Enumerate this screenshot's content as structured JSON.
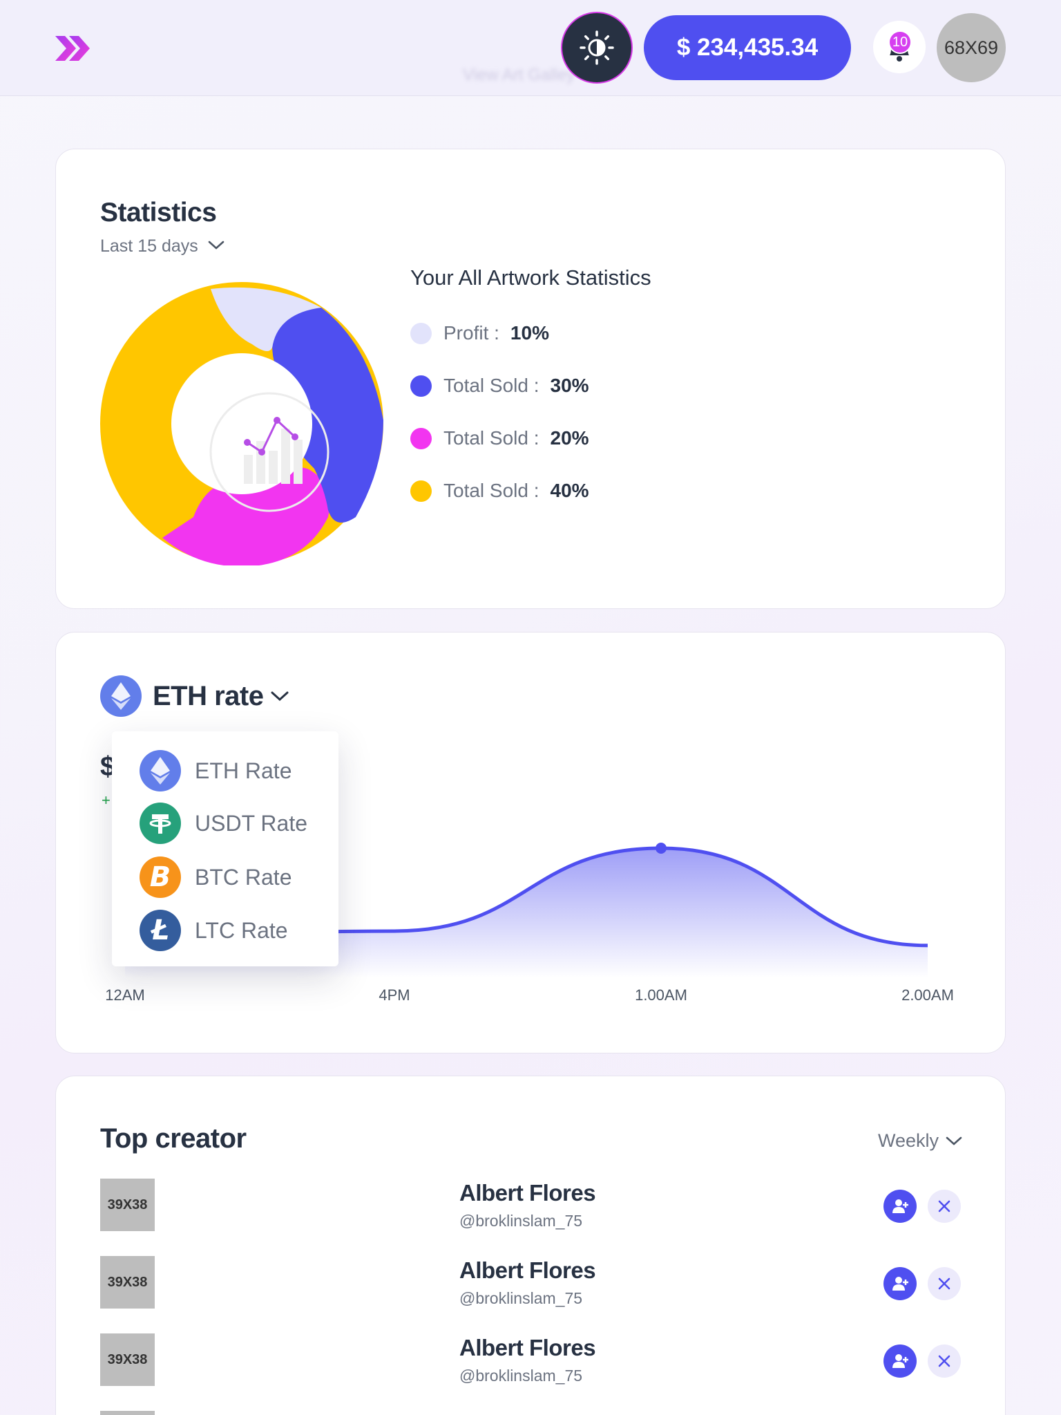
{
  "header": {
    "hint_text": "View Art Galley",
    "balance": "$ 234,435.34",
    "notification_count": "10",
    "avatar_placeholder": "68X69",
    "icons": {
      "logo": "double-chevron-right-icon",
      "theme": "sun-icon",
      "notifications": "bell-icon"
    },
    "colors": {
      "accent": "#4f4ff0",
      "brand": "#c53cf0",
      "theme_button": "#273142"
    }
  },
  "statistics": {
    "title": "Statistics",
    "range": "Last 15 days",
    "legend_title": "Your All Artwork Statistics",
    "legend": [
      {
        "label": "Profit :",
        "value": "10%",
        "color": "#e2e3fb"
      },
      {
        "label": "Total Sold :",
        "value": "30%",
        "color": "#4f4ff0"
      },
      {
        "label": "Total Sold :",
        "value": "20%",
        "color": "#f235f0"
      },
      {
        "label": "Total Sold :",
        "value": "40%",
        "color": "#ffc600"
      }
    ]
  },
  "eth_rate": {
    "title": "ETH rate",
    "hidden_value": "$",
    "hidden_change": "+",
    "dropdown": [
      {
        "label": "ETH Rate",
        "icon": "ethereum-icon",
        "color": "#627eea"
      },
      {
        "label": "USDT Rate",
        "icon": "tether-icon",
        "color": "#26a17b"
      },
      {
        "label": "BTC Rate",
        "icon": "bitcoin-icon",
        "color": "#f7931a"
      },
      {
        "label": "LTC Rate",
        "icon": "litecoin-icon",
        "color": "#345d9d"
      }
    ]
  },
  "chart_data": {
    "type": "area",
    "x": [
      "12AM",
      "4PM",
      "1.00AM",
      "2.00AM"
    ],
    "values": [
      0.2,
      0.25,
      1.0,
      0.12
    ],
    "highlight_index": 2,
    "color": "#4f4ff0",
    "title": "",
    "xlabel": "",
    "ylabel": ""
  },
  "top_creator": {
    "title": "Top creator",
    "filter": "Weekly",
    "creators": [
      {
        "thumb": "39X38",
        "name": "Albert Flores",
        "handle": "@broklinslam_75"
      },
      {
        "thumb": "39X38",
        "name": "Albert Flores",
        "handle": "@broklinslam_75"
      },
      {
        "thumb": "39X38",
        "name": "Albert Flores",
        "handle": "@broklinslam_75"
      }
    ]
  }
}
